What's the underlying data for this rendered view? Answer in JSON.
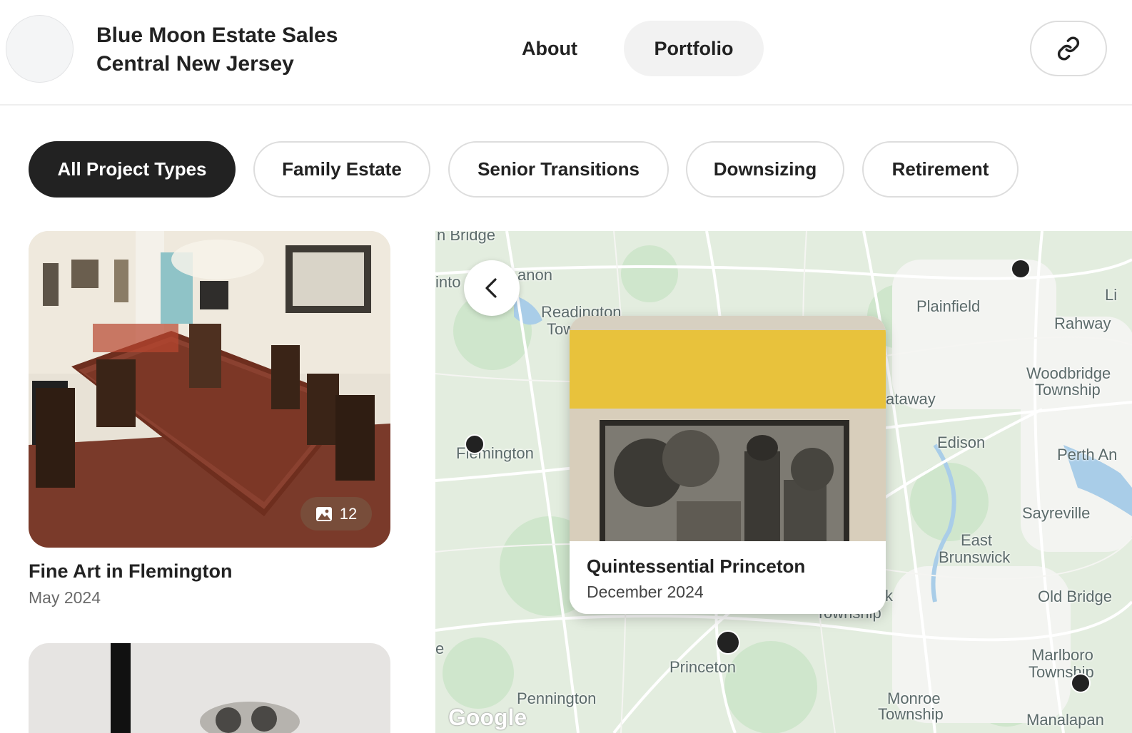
{
  "header": {
    "brand_line1": "Blue Moon Estate Sales",
    "brand_line2": "Central New Jersey",
    "nav": {
      "about": "About",
      "portfolio": "Portfolio"
    }
  },
  "filters": [
    "All Project Types",
    "Family Estate",
    "Senior Transitions",
    "Downsizing",
    "Retirement"
  ],
  "cards": [
    {
      "title": "Fine Art in Flemington",
      "date": "May 2024",
      "photo_count": "12"
    }
  ],
  "map": {
    "labels": {
      "bridge": "n Bridge",
      "anon": "anon",
      "into": "into",
      "readington": "Readington",
      "tow": "Tow",
      "plainfield": "Plainfield",
      "li": "Li",
      "rahway": "Rahway",
      "woodbridge1": "Woodbridge",
      "woodbridge2": "Township",
      "ataway": "ataway",
      "edison": "Edison",
      "perth": "Perth An",
      "flemington": "Flemington",
      "sayreville": "Sayreville",
      "eastbrunswick1": "East",
      "eastbrunswick2": "Brunswick",
      "k": "k",
      "township_partial": "Township",
      "oldbridge": "Old Bridge",
      "e": "e",
      "princeton": "Princeton",
      "marlboro1": "Marlboro",
      "marlboro2": "Township",
      "pennington": "Pennington",
      "monroe1": "Monroe",
      "monroe2": "Township",
      "manalapan": "Manalapan",
      "google": "Google"
    },
    "popup": {
      "title": "Quintessential Princeton",
      "date": "December 2024"
    }
  }
}
